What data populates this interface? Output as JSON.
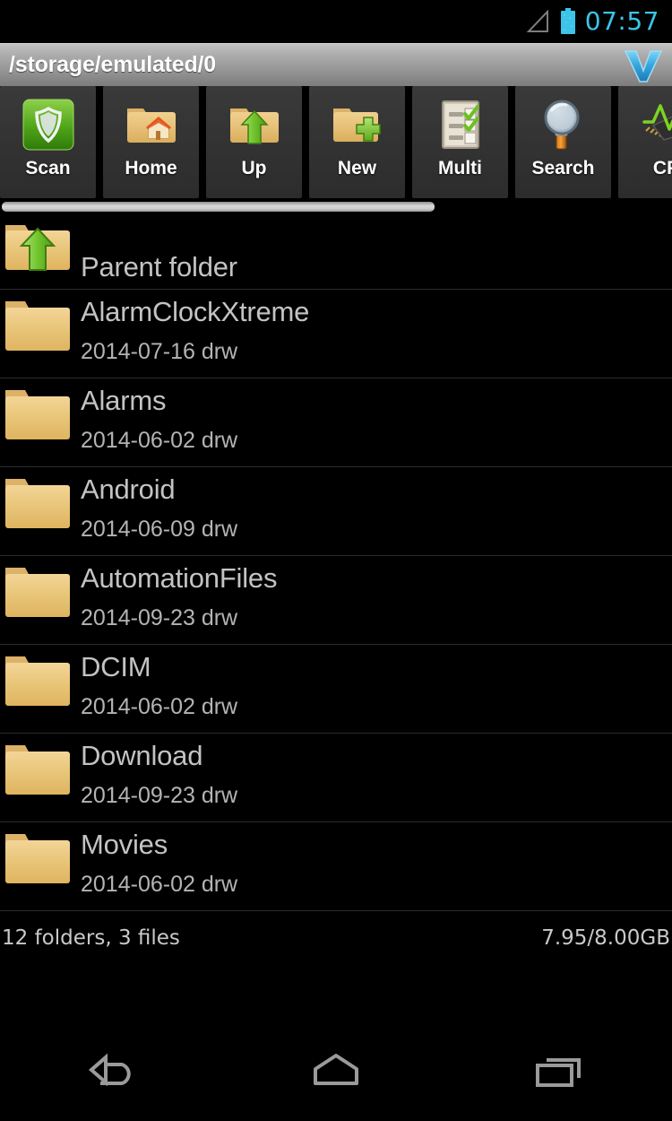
{
  "statusbar": {
    "time": "07:57",
    "signal_icon": "signal-triangle-icon",
    "battery_icon": "battery-icon",
    "accent_color": "#3cc5e8"
  },
  "pathbar": {
    "path": "/storage/emulated/0",
    "logo_icon": "v-logo-icon"
  },
  "toolbar": {
    "buttons": [
      {
        "label": "Scan",
        "icon": "shield-scan-icon"
      },
      {
        "label": "Home",
        "icon": "folder-home-icon"
      },
      {
        "label": "Up",
        "icon": "folder-up-arrow-icon"
      },
      {
        "label": "New",
        "icon": "folder-plus-icon"
      },
      {
        "label": "Multi",
        "icon": "checklist-icon"
      },
      {
        "label": "Search",
        "icon": "magnifier-icon"
      },
      {
        "label": "CP",
        "icon": "cpu-graph-icon"
      }
    ]
  },
  "filelist": {
    "parent": {
      "name": "Parent folder",
      "icon": "folder-up-arrow-icon"
    },
    "rows": [
      {
        "name": "AlarmClockXtreme",
        "meta": "2014-07-16 drw",
        "icon": "folder-icon"
      },
      {
        "name": "Alarms",
        "meta": "2014-06-02 drw",
        "icon": "folder-icon"
      },
      {
        "name": "Android",
        "meta": "2014-06-09 drw",
        "icon": "folder-icon"
      },
      {
        "name": "AutomationFiles",
        "meta": "2014-09-23 drw",
        "icon": "folder-icon"
      },
      {
        "name": "DCIM",
        "meta": "2014-06-02 drw",
        "icon": "folder-icon"
      },
      {
        "name": "Download",
        "meta": "2014-09-23 drw",
        "icon": "folder-icon"
      },
      {
        "name": "Movies",
        "meta": "2014-06-02 drw",
        "icon": "folder-icon"
      }
    ]
  },
  "liststatus": {
    "counts": "12 folders, 3 files",
    "storage": "7.95/8.00GB"
  },
  "navbar": {
    "buttons": [
      {
        "icon": "back-icon"
      },
      {
        "icon": "home-icon"
      },
      {
        "icon": "recents-icon"
      }
    ]
  }
}
